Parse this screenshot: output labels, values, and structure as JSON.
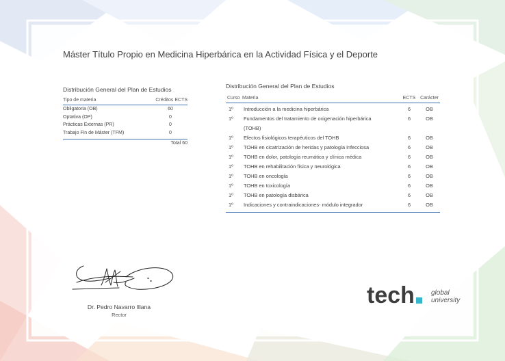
{
  "document": {
    "title": "Máster Título Propio en Medicina Hiperbárica en la Actividad Física y el Deporte"
  },
  "summary_table": {
    "heading": "Distribución General del Plan de Estudios",
    "col_type": "Tipo de materia",
    "col_credits": "Créditos ECTS",
    "rows": [
      {
        "type": "Obligatoria (OB)",
        "credits": "60"
      },
      {
        "type": "Optativa (OP)",
        "credits": "0"
      },
      {
        "type": "Prácticas Externas (PR)",
        "credits": "0"
      },
      {
        "type": "Trabajo Fin de Máster (TFM)",
        "credits": "0"
      }
    ],
    "total": "Total 60"
  },
  "subjects_table": {
    "heading": "Distribución General del Plan de Estudios",
    "col_course": "Curso",
    "col_subject": "Materia",
    "col_ects": "ECTS",
    "col_character": "Carácter",
    "rows": [
      {
        "course": "1º",
        "subject": "Introducción a la medicina hiperbárica",
        "ects": "6",
        "character": "OB"
      },
      {
        "course": "1º",
        "subject": "Fundamentos del tratamiento de oxigenación hiperbárica",
        "subject_cont": "(TOHB)",
        "ects": "6",
        "character": "OB"
      },
      {
        "course": "1º",
        "subject": "Efectos fisiológicos terapéuticos del TOHB",
        "ects": "6",
        "character": "OB"
      },
      {
        "course": "1º",
        "subject": "TOHB en cicatrización de heridas y patología infecciosa",
        "ects": "6",
        "character": "OB"
      },
      {
        "course": "1º",
        "subject": "TOHB en dolor, patología reumática y clínica médica",
        "ects": "6",
        "character": "OB"
      },
      {
        "course": "1º",
        "subject": "TOHB en rehabilitación física y neurológica",
        "ects": "6",
        "character": "OB"
      },
      {
        "course": "1º",
        "subject": "TOHB en oncología",
        "ects": "6",
        "character": "OB"
      },
      {
        "course": "1º",
        "subject": "TOHB en toxicología",
        "ects": "6",
        "character": "OB"
      },
      {
        "course": "1º",
        "subject": "TOHB en patología disbárica",
        "ects": "6",
        "character": "OB"
      },
      {
        "course": "1º",
        "subject": "Indicaciones y contraindicaciones- módulo integrador",
        "ects": "6",
        "character": "OB"
      }
    ]
  },
  "signatory": {
    "name": "Dr. Pedro Navarro Illana",
    "role": "Rector"
  },
  "logo": {
    "wordmark": "tech",
    "line1": "global",
    "line2": "university",
    "accent_color": "#36b8cc",
    "text_color": "#3d3d3d"
  },
  "colors": {
    "rule": "#3a6fb0",
    "frame": "#ffffff"
  }
}
